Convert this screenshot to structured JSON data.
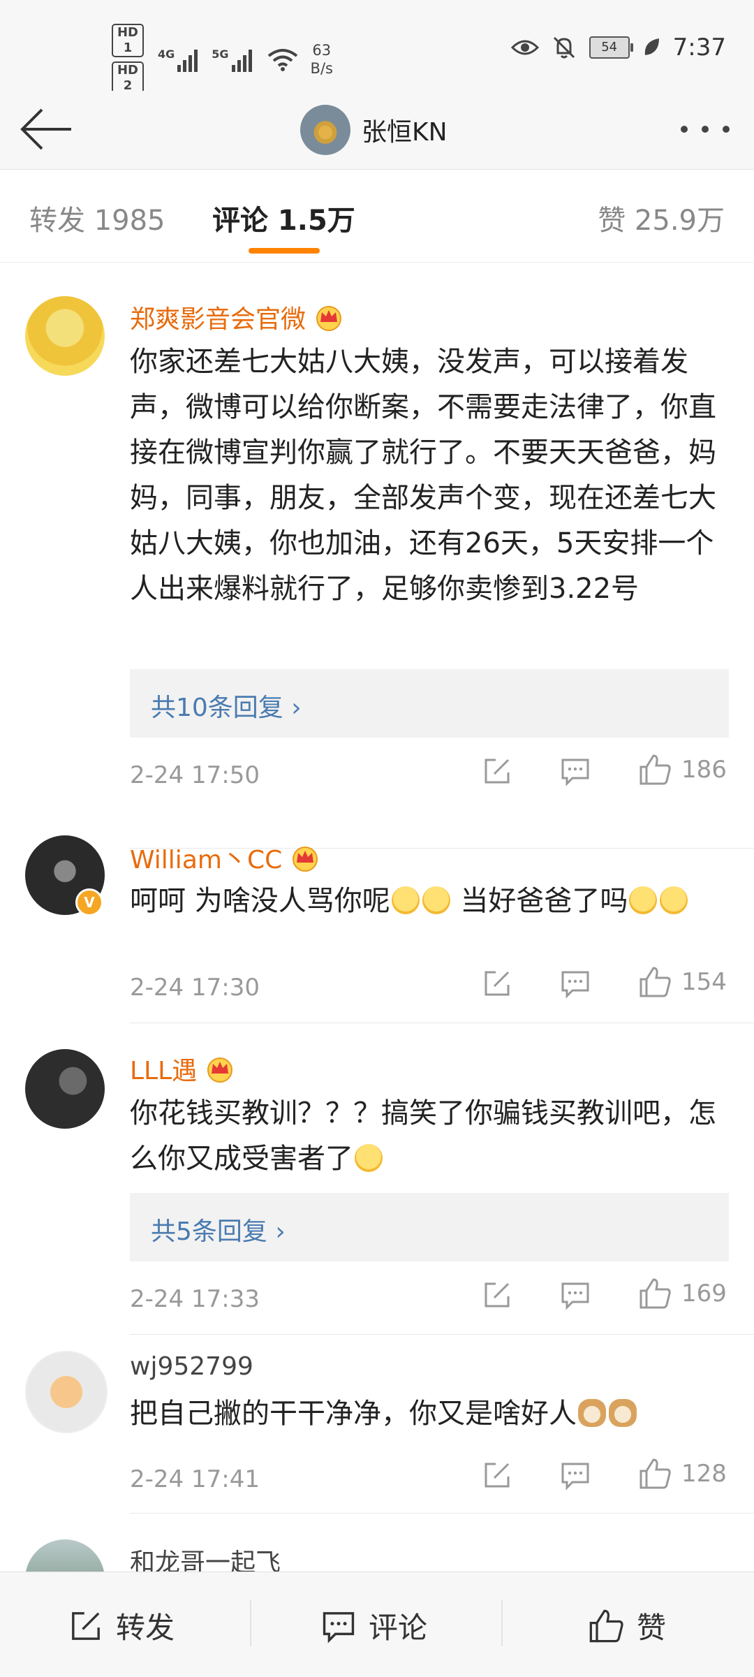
{
  "status_bar": {
    "hd1": "HD 1",
    "hd2": "HD 2",
    "net1": "4G",
    "net2": "5G",
    "speed_value": "63",
    "speed_unit": "B/s",
    "battery": "54",
    "time": "7:37"
  },
  "nav": {
    "title": "张恒KN"
  },
  "tabs": {
    "repost_label": "转发 1985",
    "comments_label": "评论 1.5万",
    "likes_label": "赞 25.9万",
    "accent": "#ff8200"
  },
  "comments": [
    {
      "user": "郑爽影音会官微",
      "text": "你家还差七大姑八大姨，没发声，可以接着发声，微博可以给你断案，不需要走法律了，你直接在微博宣判你赢了就行了。不要天天爸爸，妈妈，同事，朋友，全部发声个变，现在还差七大姑八大姨，你也加油，还有26天，5天安排一个人出来爆料就行了，足够你卖惨到3.22号",
      "replies": "共10条回复 ›",
      "time": "2-24 17:50",
      "likes": "186"
    },
    {
      "user": "William丶CC",
      "text_part1": "呵呵  为啥没人骂你呢",
      "text_part2": " 当好爸爸了吗",
      "time": "2-24 17:30",
      "likes": "154"
    },
    {
      "user": "LLL遇",
      "text": "你花钱买教训？？？搞笑了你骗钱买教训吧，怎么你又成受害者了",
      "replies": "共5条回复 ›",
      "time": "2-24 17:33",
      "likes": "169"
    },
    {
      "user": "wj952799",
      "text": "把自己撇的干干净净，你又是啥好人",
      "time": "2-24 17:41",
      "likes": "128"
    },
    {
      "user": "和龙哥一起飞"
    }
  ],
  "bottom_bar": {
    "repost": "转发",
    "comment": "评论",
    "like": "赞"
  }
}
